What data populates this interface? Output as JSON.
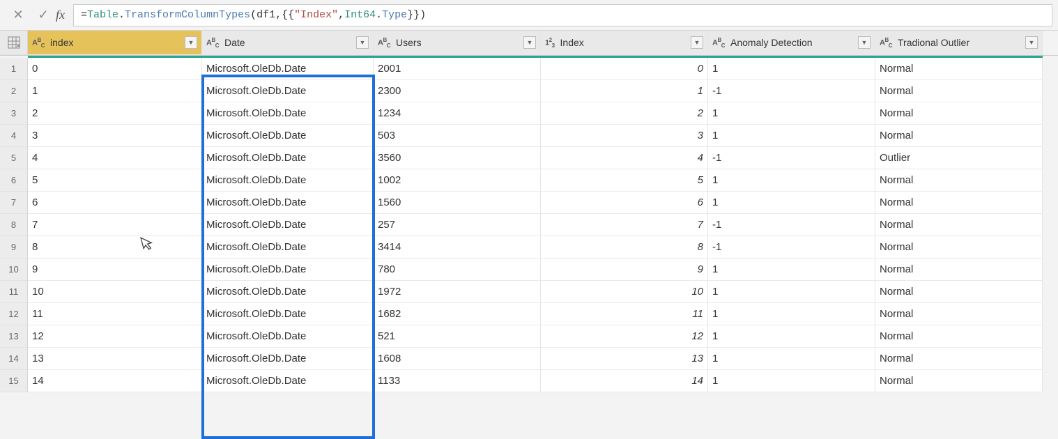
{
  "formula": {
    "prefix": "= ",
    "typ1": "Table",
    "dot1": ".",
    "kw1": "TransformColumnTypes",
    "open": "(df1,{{",
    "str1": "\"Index\"",
    "comma": ", ",
    "typ2": "Int64",
    "dot2": ".",
    "kw2": "Type",
    "close": "}})"
  },
  "columns": [
    {
      "label": "index",
      "type_icon": "ABC",
      "selected": true
    },
    {
      "label": "Date",
      "type_icon": "ABC",
      "selected": false
    },
    {
      "label": "Users",
      "type_icon": "ABC",
      "selected": false
    },
    {
      "label": "Index",
      "type_icon": "123",
      "selected": false
    },
    {
      "label": "Anomaly Detection",
      "type_icon": "ABC",
      "selected": false
    },
    {
      "label": "Tradional Outlier",
      "type_icon": "ABC",
      "selected": false
    }
  ],
  "rows": [
    {
      "n": "1",
      "idx": "0",
      "date": "Microsoft.OleDb.Date",
      "users": "2001",
      "index2": "0",
      "anom": "1",
      "trad": "Normal"
    },
    {
      "n": "2",
      "idx": "1",
      "date": "Microsoft.OleDb.Date",
      "users": "2300",
      "index2": "1",
      "anom": "-1",
      "trad": "Normal"
    },
    {
      "n": "3",
      "idx": "2",
      "date": "Microsoft.OleDb.Date",
      "users": "1234",
      "index2": "2",
      "anom": "1",
      "trad": "Normal"
    },
    {
      "n": "4",
      "idx": "3",
      "date": "Microsoft.OleDb.Date",
      "users": "503",
      "index2": "3",
      "anom": "1",
      "trad": "Normal"
    },
    {
      "n": "5",
      "idx": "4",
      "date": "Microsoft.OleDb.Date",
      "users": "3560",
      "index2": "4",
      "anom": "-1",
      "trad": "Outlier"
    },
    {
      "n": "6",
      "idx": "5",
      "date": "Microsoft.OleDb.Date",
      "users": "1002",
      "index2": "5",
      "anom": "1",
      "trad": "Normal"
    },
    {
      "n": "7",
      "idx": "6",
      "date": "Microsoft.OleDb.Date",
      "users": "1560",
      "index2": "6",
      "anom": "1",
      "trad": "Normal"
    },
    {
      "n": "8",
      "idx": "7",
      "date": "Microsoft.OleDb.Date",
      "users": "257",
      "index2": "7",
      "anom": "-1",
      "trad": "Normal"
    },
    {
      "n": "9",
      "idx": "8",
      "date": "Microsoft.OleDb.Date",
      "users": "3414",
      "index2": "8",
      "anom": "-1",
      "trad": "Normal"
    },
    {
      "n": "10",
      "idx": "9",
      "date": "Microsoft.OleDb.Date",
      "users": "780",
      "index2": "9",
      "anom": "1",
      "trad": "Normal"
    },
    {
      "n": "11",
      "idx": "10",
      "date": "Microsoft.OleDb.Date",
      "users": "1972",
      "index2": "10",
      "anom": "1",
      "trad": "Normal"
    },
    {
      "n": "12",
      "idx": "11",
      "date": "Microsoft.OleDb.Date",
      "users": "1682",
      "index2": "11",
      "anom": "1",
      "trad": "Normal"
    },
    {
      "n": "13",
      "idx": "12",
      "date": "Microsoft.OleDb.Date",
      "users": "521",
      "index2": "12",
      "anom": "1",
      "trad": "Normal"
    },
    {
      "n": "14",
      "idx": "13",
      "date": "Microsoft.OleDb.Date",
      "users": "1608",
      "index2": "13",
      "anom": "1",
      "trad": "Normal"
    },
    {
      "n": "15",
      "idx": "14",
      "date": "Microsoft.OleDb.Date",
      "users": "1133",
      "index2": "14",
      "anom": "1",
      "trad": "Normal"
    }
  ],
  "icons": {
    "cancel": "✕",
    "confirm": "✓",
    "fx": "fx",
    "dropdown": "▼"
  }
}
